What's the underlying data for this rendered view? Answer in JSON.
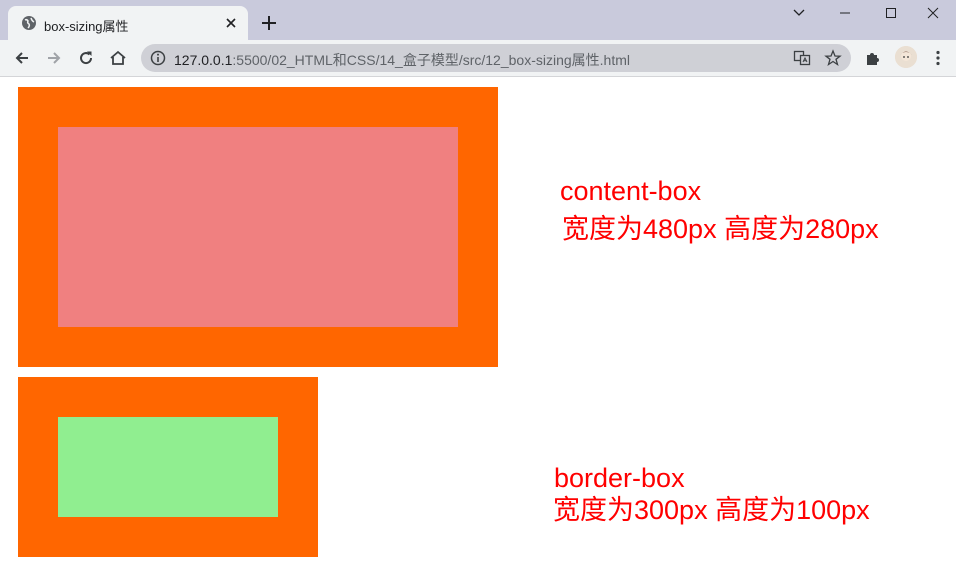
{
  "browser": {
    "tab": {
      "title": "box-sizing属性",
      "favicon": "globe-icon",
      "close": "close-icon"
    },
    "new_tab": "plus-icon",
    "window_controls": [
      "chevron-down-icon",
      "minimize-icon",
      "maximize-icon",
      "close-icon"
    ],
    "toolbar": {
      "back": "arrow-left-icon",
      "forward": "arrow-right-icon",
      "reload": "reload-icon",
      "home": "home-icon",
      "extensions": "puzzle-icon",
      "menu": "kebab-menu-icon"
    },
    "address_bar": {
      "info": "info-icon",
      "url_host": "127.0.0.1",
      "url_path": ":5500/02_HTML和CSS/14_盒子模型/src/12_box-sizing属性.html",
      "translate": "translate-icon",
      "bookmark": "star-icon"
    }
  },
  "page": {
    "box1": {
      "outer_color": "#ff6600",
      "inner_color": "#f08080",
      "label_line1": "content-box",
      "label_line2": "宽度为480px 高度为280px"
    },
    "box2": {
      "outer_color": "#ff6600",
      "inner_color": "#90ee90",
      "label_line1": "border-box",
      "label_line2": "宽度为300px 高度为100px"
    },
    "label_color": "#ff0000"
  }
}
